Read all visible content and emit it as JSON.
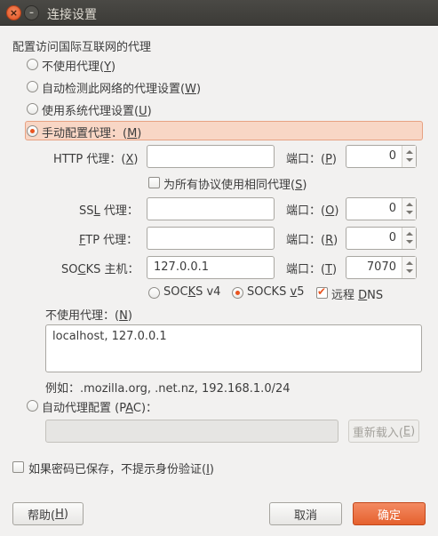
{
  "window": {
    "title": "连接设置"
  },
  "section_title": "配置访问国际互联网的代理",
  "proxy_modes": {
    "none_pre": "不使用代理(",
    "none_key": "Y",
    "none_post": ")",
    "auto_pre": "自动检测此网络的代理设置(",
    "auto_key": "W",
    "auto_post": ")",
    "system_pre": "使用系统代理设置(",
    "system_key": "U",
    "system_post": ")",
    "manual_pre": "手动配置代理：(",
    "manual_key": "M",
    "manual_post": ")"
  },
  "http": {
    "label_pre": "HTTP 代理：(",
    "label_key": "X",
    "label_post": ")",
    "host": "",
    "port_pre": "端口：(",
    "port_key": "P",
    "port_post": ")",
    "port": "0"
  },
  "same_proxy": {
    "pre": "为所有协议使用相同代理(",
    "key": "S",
    "post": ")"
  },
  "ssl": {
    "label_a": "SS",
    "label_key": "L",
    "label_b": " 代理：",
    "host": "",
    "port_pre": "端口：(",
    "port_key": "O",
    "port_post": ")",
    "port": "0"
  },
  "ftp": {
    "label_key": "F",
    "label_b": "TP 代理：",
    "host": "",
    "port_pre": "端口：(",
    "port_key": "R",
    "port_post": ")",
    "port": "0"
  },
  "socks": {
    "label_a": "SO",
    "label_key": "C",
    "label_b": "KS 主机：",
    "host": "127.0.0.1",
    "port_pre": "端口：(",
    "port_key": "T",
    "port_post": ")",
    "port": "7070"
  },
  "socks_options": {
    "v4_a": "SOC",
    "v4_key": "K",
    "v4_b": "S v4",
    "v5_a": "SOCKS ",
    "v5_key": "v",
    "v5_b": "5",
    "dns_a": "远程 ",
    "dns_key": "D",
    "dns_b": "NS"
  },
  "no_proxy": {
    "pre": "不使用代理：(",
    "key": "N",
    "post": ")",
    "value": "localhost, 127.0.0.1",
    "example": "例如：.mozilla.org, .net.nz, 192.168.1.0/24"
  },
  "pac": {
    "pre": "自动代理配置 (P",
    "key": "A",
    "post": "C)：",
    "url": "",
    "reload_pre": "重新载入(",
    "reload_key": "E",
    "reload_post": ")"
  },
  "no_auth_prompt": {
    "pre": "如果密码已保存，不提示身份验证(",
    "key": "I",
    "post": ")"
  },
  "buttons": {
    "help_pre": "帮助(",
    "help_key": "H",
    "help_post": ")",
    "cancel": "取消",
    "ok": "确定"
  },
  "colors": {
    "accent": "#e95420",
    "titlebar": "#3c3b37",
    "background": "#f2f1f0"
  }
}
